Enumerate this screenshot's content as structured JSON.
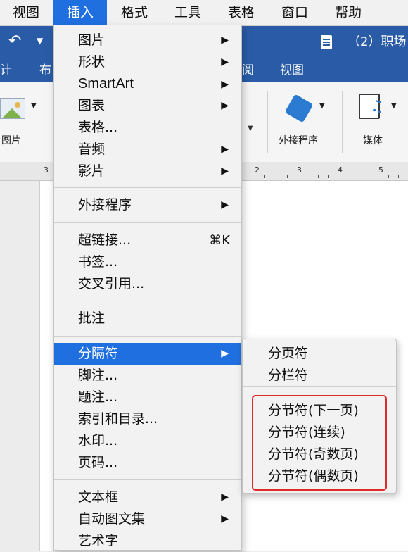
{
  "menubar": {
    "items": [
      {
        "label": "视图",
        "active": false
      },
      {
        "label": "插入",
        "active": true
      },
      {
        "label": "格式",
        "active": false
      },
      {
        "label": "工具",
        "active": false
      },
      {
        "label": "表格",
        "active": false
      },
      {
        "label": "窗口",
        "active": false
      },
      {
        "label": "帮助",
        "active": false
      }
    ]
  },
  "titlebar": {
    "undo_icon": "undo-icon",
    "doc_title": "（2）职场"
  },
  "ribbon": {
    "tabs": [
      "计",
      "布",
      "阅",
      "视图"
    ],
    "groups": {
      "pictures": "图片",
      "addins": "外接程序",
      "media": "媒体"
    }
  },
  "ruler": {
    "labels": [
      "3",
      "2",
      "3",
      "4",
      "5"
    ]
  },
  "insert_menu": {
    "items": [
      {
        "label": "图片",
        "submenu": true
      },
      {
        "label": "形状",
        "submenu": true
      },
      {
        "label": "SmartArt",
        "submenu": true
      },
      {
        "label": "图表",
        "submenu": true
      },
      {
        "label": "表格...",
        "submenu": false
      },
      {
        "label": "音频",
        "submenu": true
      },
      {
        "label": "影片",
        "submenu": true
      },
      {
        "label": "外接程序",
        "submenu": true
      },
      {
        "label": "超链接...",
        "shortcut": "⌘K"
      },
      {
        "label": "书签..."
      },
      {
        "label": "交叉引用..."
      },
      {
        "label": "批注"
      },
      {
        "label": "分隔符",
        "submenu": true,
        "highlighted": true
      },
      {
        "label": "脚注..."
      },
      {
        "label": "题注..."
      },
      {
        "label": "索引和目录..."
      },
      {
        "label": "水印..."
      },
      {
        "label": "页码..."
      },
      {
        "label": "文本框",
        "submenu": true
      },
      {
        "label": "自动图文集",
        "submenu": true
      },
      {
        "label": "艺术字"
      }
    ],
    "arrow_glyph": "▶"
  },
  "break_submenu": {
    "items": [
      "分页符",
      "分栏符",
      "分节符(下一页)",
      "分节符(连续)",
      "分节符(奇数页)",
      "分节符(偶数页)"
    ],
    "highlight_color": "#e02a2a"
  },
  "colors": {
    "accent": "#1f6fe0",
    "word_blue": "#2a5ba6"
  }
}
